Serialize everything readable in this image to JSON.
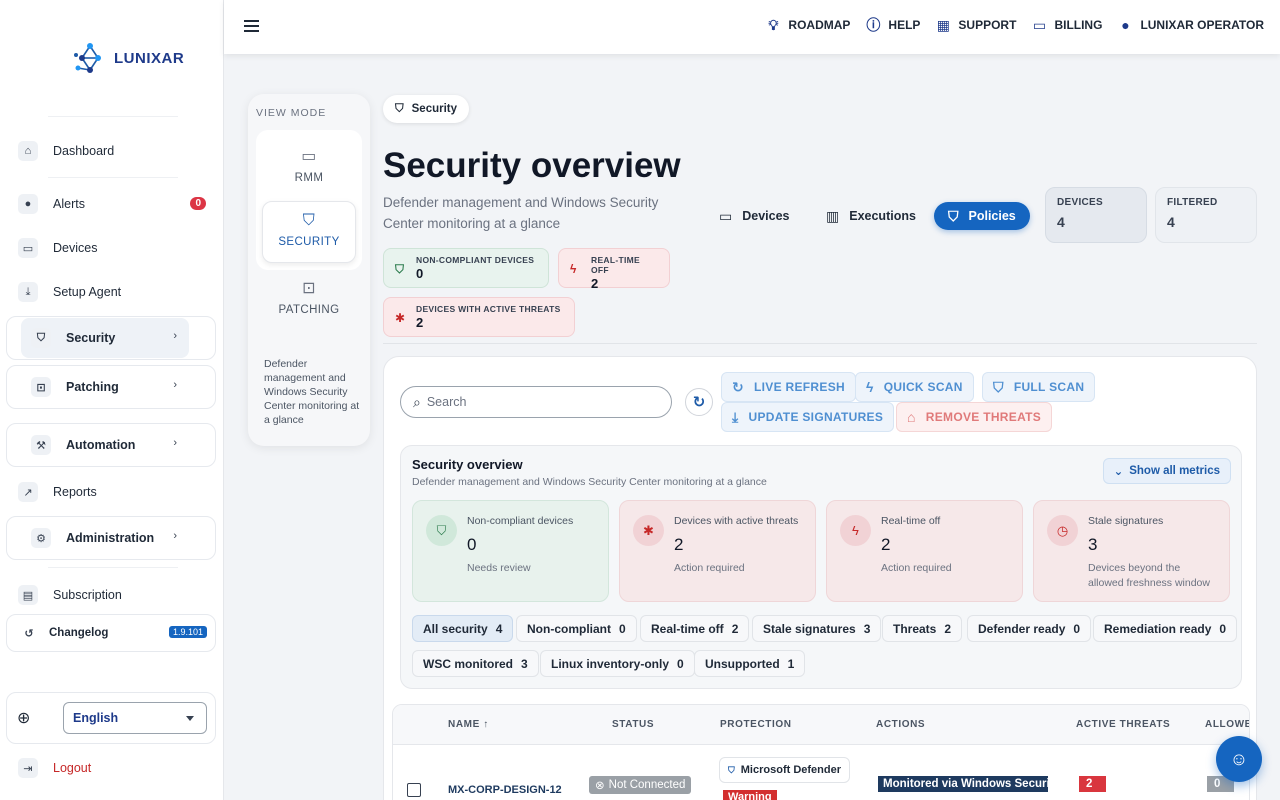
{
  "brand": {
    "name": "LUNIXAR"
  },
  "topbar": {
    "links": [
      {
        "label": "ROADMAP",
        "icon": "lightbulb-icon"
      },
      {
        "label": "HELP",
        "icon": "help-circle-icon"
      },
      {
        "label": "SUPPORT",
        "icon": "ticket-icon"
      },
      {
        "label": "BILLING",
        "icon": "credit-card-icon"
      },
      {
        "label": "LUNIXAR OPERATOR",
        "icon": "user-icon"
      }
    ]
  },
  "sidebar": {
    "dashboard": "Dashboard",
    "alerts": "Alerts",
    "alerts_count": "0",
    "devices": "Devices",
    "setup_agent": "Setup Agent",
    "security": "Security",
    "patching": "Patching",
    "automation": "Automation",
    "reports": "Reports",
    "administration": "Administration",
    "subscription": "Subscription",
    "changelog": "Changelog",
    "version": "1.9.101",
    "language": "English",
    "logout": "Logout"
  },
  "view_mode": {
    "title": "VIEW MODE",
    "items": [
      "RMM",
      "SECURITY",
      "PATCHING"
    ],
    "active": "SECURITY",
    "description": "Defender management and Windows Security Center monitoring at a glance"
  },
  "header": {
    "crumb": "Security",
    "title": "Security overview",
    "subtitle": "Defender management and Windows Security Center monitoring at a glance",
    "chips": [
      {
        "label": "NON-COMPLIANT DEVICES",
        "value": "0"
      },
      {
        "label": "REAL-TIME OFF",
        "value": "2"
      },
      {
        "label": "DEVICES WITH ACTIVE THREATS",
        "value": "2"
      }
    ],
    "segments": [
      "Devices",
      "Executions",
      "Policies"
    ],
    "active_segment": "Policies",
    "kpis": [
      {
        "label": "DEVICES",
        "value": "4"
      },
      {
        "label": "FILTERED",
        "value": "4"
      }
    ]
  },
  "toolbar": {
    "search_placeholder": "Search",
    "actions": [
      "LIVE REFRESH",
      "QUICK SCAN",
      "FULL SCAN",
      "UPDATE SIGNATURES",
      "REMOVE THREATS"
    ]
  },
  "overview": {
    "title": "Security overview",
    "subtitle": "Defender management and Windows Security Center monitoring at a glance",
    "show_all": "Show all metrics",
    "metrics": [
      {
        "label": "Non-compliant devices",
        "value": "0",
        "note": "Needs review"
      },
      {
        "label": "Devices with active threats",
        "value": "2",
        "note": "Action required"
      },
      {
        "label": "Real-time off",
        "value": "2",
        "note": "Action required"
      },
      {
        "label": "Stale signatures",
        "value": "3",
        "note": "Devices beyond the allowed freshness window"
      }
    ],
    "filters": [
      {
        "label": "All security",
        "count": "4"
      },
      {
        "label": "Non-compliant",
        "count": "0"
      },
      {
        "label": "Real-time off",
        "count": "2"
      },
      {
        "label": "Stale signatures",
        "count": "3"
      },
      {
        "label": "Threats",
        "count": "2"
      },
      {
        "label": "Defender ready",
        "count": "0"
      },
      {
        "label": "Remediation ready",
        "count": "0"
      },
      {
        "label": "WSC monitored",
        "count": "3"
      },
      {
        "label": "Linux inventory-only",
        "count": "0"
      },
      {
        "label": "Unsupported",
        "count": "1"
      }
    ]
  },
  "table": {
    "columns": [
      "NAME",
      "STATUS",
      "PROTECTION",
      "ACTIONS",
      "ACTIVE THREATS",
      "ALLOWED"
    ],
    "rows": [
      {
        "name": "MX-CORP-DESIGN-12",
        "status": "Not Connected",
        "protection": "Microsoft Defender",
        "protection_badge": "Warning",
        "action": "Monitored via Windows Security Center",
        "active_threats": "2",
        "allowed": "0"
      }
    ]
  },
  "colors": {
    "accent": "#1565c0",
    "danger": "#d9363e",
    "success": "#2e7d4f"
  }
}
